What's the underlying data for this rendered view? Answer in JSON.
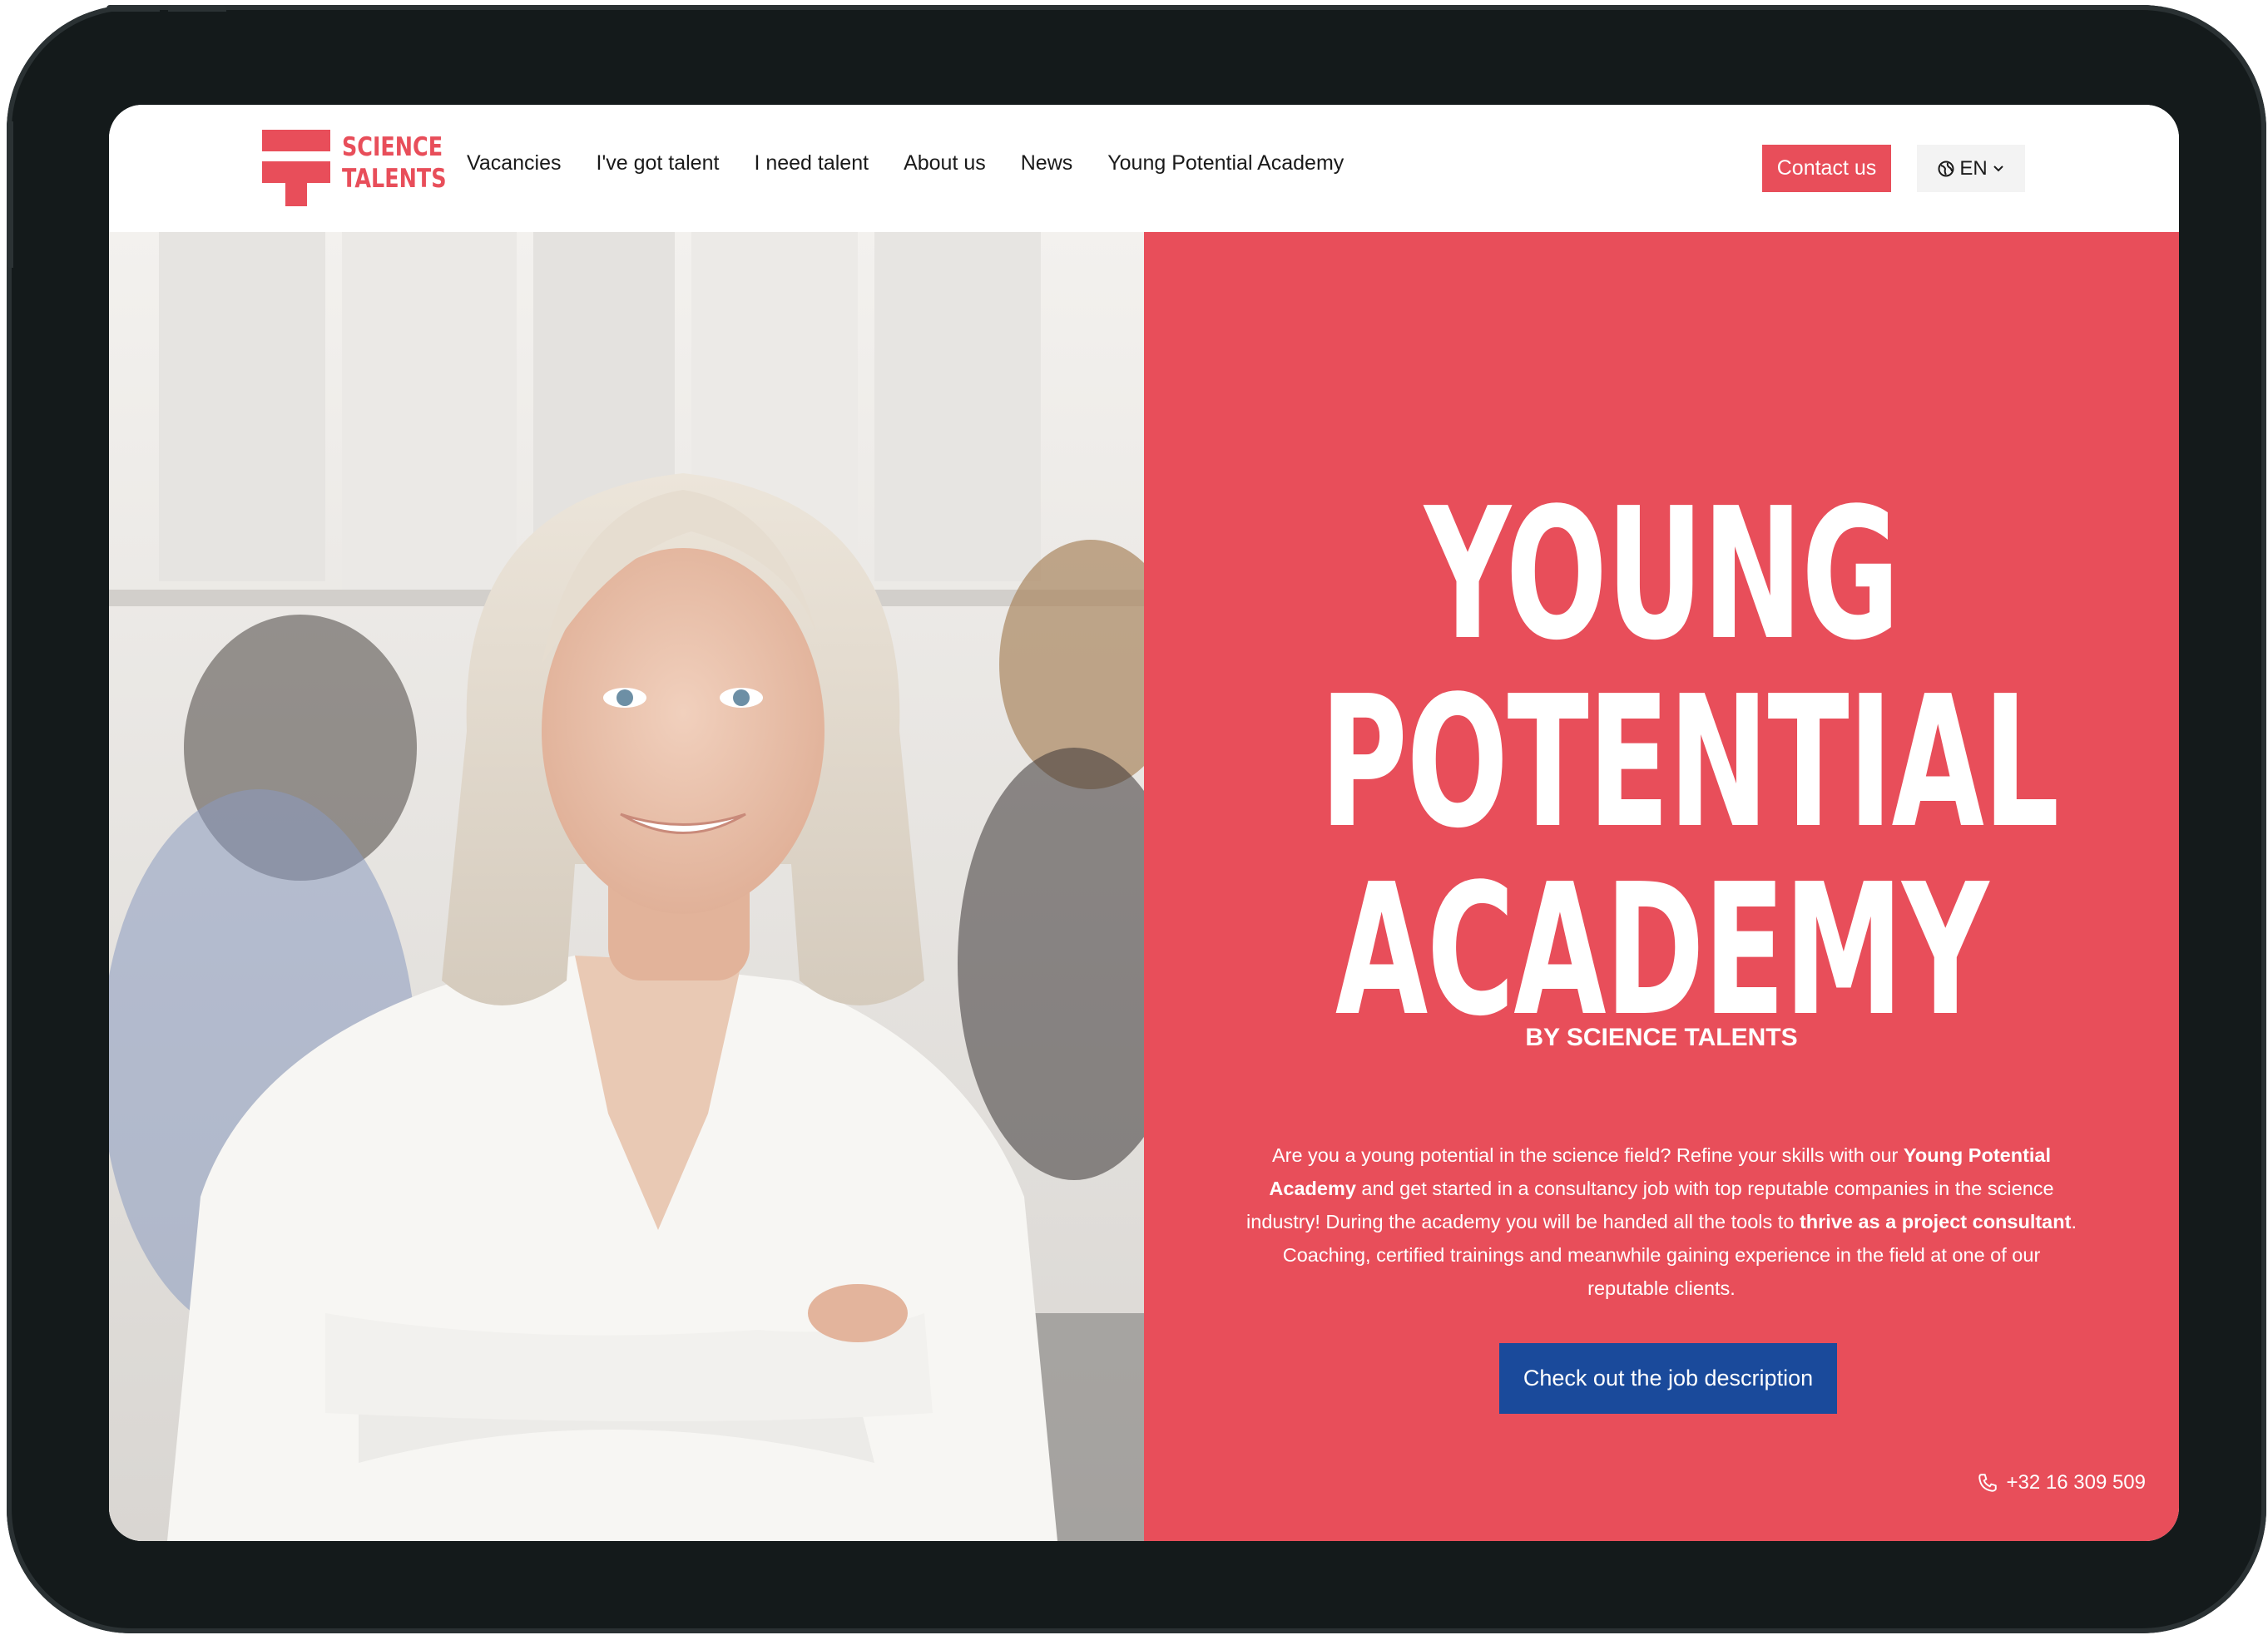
{
  "brand": {
    "logo_line1": "SCIENCE",
    "logo_line2": "TALENTS",
    "accent_color": "#e84e5a",
    "cta_color": "#1a4a9b"
  },
  "nav": {
    "items": [
      {
        "label": "Vacancies"
      },
      {
        "label": "I've got talent"
      },
      {
        "label": "I need talent"
      },
      {
        "label": "About us"
      },
      {
        "label": "News"
      },
      {
        "label": "Young Potential Academy"
      }
    ],
    "contact_label": "Contact us",
    "language": {
      "icon": "globe-icon",
      "label": "EN",
      "caret_icon": "chevron-down-icon"
    }
  },
  "hero": {
    "headline_lines": [
      "YOUNG",
      "POTENTIAL",
      "ACADEMY"
    ],
    "subheadline": "BY SCIENCE TALENTS",
    "paragraph": {
      "part1": "Are you a young potential in the science field? Refine your skills with our ",
      "bold1": "Young Potential Academy",
      "part2": " and get started in a consultancy job with top reputable companies in the science industry! During the academy you will be handed all the tools to ",
      "bold2": "thrive as a project consultant",
      "part3": ". Coaching, certified trainings and meanwhile gaining experience in the field at one of our reputable clients."
    },
    "cta_label": "Check out the job description",
    "phone": {
      "icon": "phone-icon",
      "number": "+32 16 309 509"
    }
  }
}
